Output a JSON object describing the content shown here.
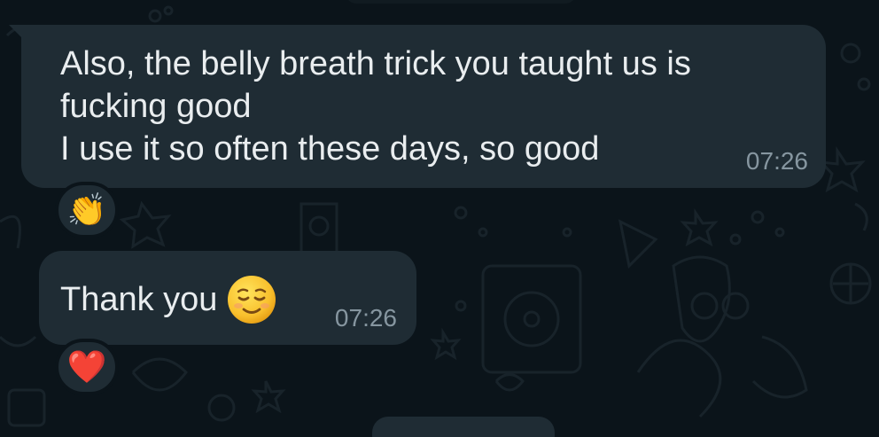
{
  "messages": [
    {
      "text": "Also, the belly breath trick you taught us is\nfucking good\nI use it so often these days, so good",
      "time": "07:26",
      "reaction": "👏"
    },
    {
      "text": "Thank you",
      "emoji_icon": "relieved-face-icon",
      "time": "07:26",
      "reaction": "❤️"
    }
  ],
  "colors": {
    "background": "#0b141a",
    "bubble": "#1f2c34",
    "text": "#e9edef",
    "timestamp": "#8696a0"
  }
}
